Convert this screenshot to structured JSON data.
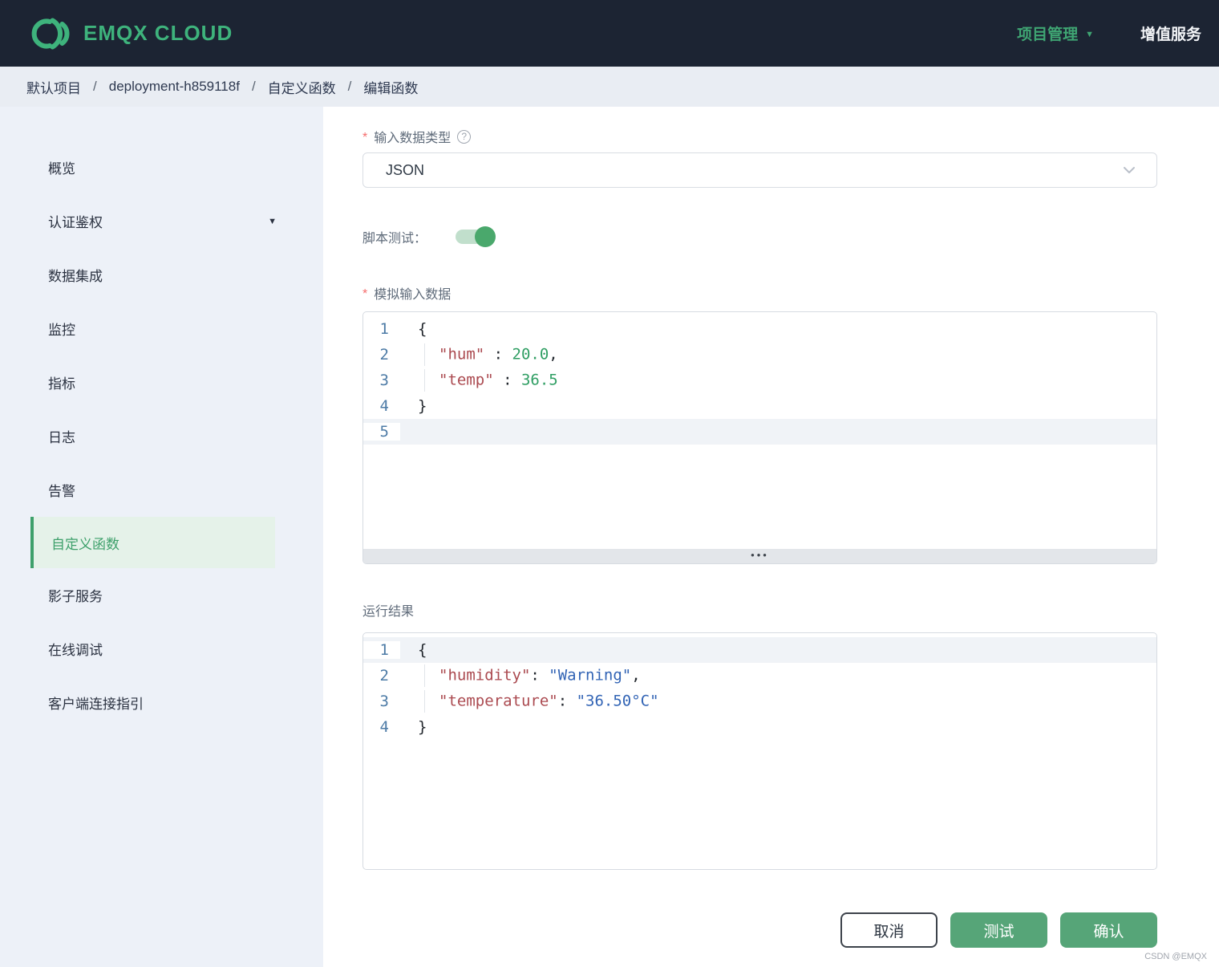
{
  "navbar": {
    "brand": "EMQX CLOUD",
    "project_menu": "项目管理",
    "value_added_services": "增值服务"
  },
  "breadcrumb": {
    "separator": "/",
    "items": [
      "默认项目",
      "deployment-h859118f",
      "自定义函数",
      "编辑函数"
    ]
  },
  "sidebar": {
    "items": [
      {
        "label": "概览",
        "active": false,
        "has_caret": false
      },
      {
        "label": "认证鉴权",
        "active": false,
        "has_caret": true
      },
      {
        "label": "数据集成",
        "active": false,
        "has_caret": false
      },
      {
        "label": "监控",
        "active": false,
        "has_caret": false
      },
      {
        "label": "指标",
        "active": false,
        "has_caret": false
      },
      {
        "label": "日志",
        "active": false,
        "has_caret": false
      },
      {
        "label": "告警",
        "active": false,
        "has_caret": false
      },
      {
        "label": "自定义函数",
        "active": true,
        "has_caret": false
      },
      {
        "label": "影子服务",
        "active": false,
        "has_caret": false
      },
      {
        "label": "在线调试",
        "active": false,
        "has_caret": false
      },
      {
        "label": "客户端连接指引",
        "active": false,
        "has_caret": false
      }
    ]
  },
  "form": {
    "input_type": {
      "required_mark": "*",
      "label": "输入数据类型",
      "help_icon": "?",
      "value": "JSON"
    },
    "script_test": {
      "label": "脚本测试：",
      "state": "on"
    },
    "sim_input": {
      "required_mark": "*",
      "label": "模拟输入数据"
    },
    "run_result": {
      "label": "运行结果"
    }
  },
  "editors": {
    "input": {
      "active_line": 5,
      "lines": [
        {
          "indent": false,
          "tokens": [
            {
              "text": "{",
              "type": "plain"
            }
          ]
        },
        {
          "indent": true,
          "tokens": [
            {
              "text": "\"hum\"",
              "type": "key"
            },
            {
              "text": " : ",
              "type": "plain"
            },
            {
              "text": "20.0",
              "type": "num"
            },
            {
              "text": ",",
              "type": "plain"
            }
          ]
        },
        {
          "indent": true,
          "tokens": [
            {
              "text": "\"temp\"",
              "type": "key"
            },
            {
              "text": " : ",
              "type": "plain"
            },
            {
              "text": "36.5",
              "type": "num"
            }
          ]
        },
        {
          "indent": false,
          "tokens": [
            {
              "text": "}",
              "type": "plain"
            }
          ]
        },
        {
          "indent": false,
          "tokens": []
        }
      ],
      "resize_dots": "•••"
    },
    "output": {
      "active_line": 1,
      "lines": [
        {
          "indent": false,
          "tokens": [
            {
              "text": "{",
              "type": "plain"
            }
          ]
        },
        {
          "indent": true,
          "tokens": [
            {
              "text": "\"humidity\"",
              "type": "key"
            },
            {
              "text": ": ",
              "type": "plain"
            },
            {
              "text": "\"Warning\"",
              "type": "str"
            },
            {
              "text": ",",
              "type": "plain"
            }
          ]
        },
        {
          "indent": true,
          "tokens": [
            {
              "text": "\"temperature\"",
              "type": "key"
            },
            {
              "text": ": ",
              "type": "plain"
            },
            {
              "text": "\"36.50°C\"",
              "type": "str"
            }
          ]
        },
        {
          "indent": false,
          "tokens": [
            {
              "text": "}",
              "type": "plain"
            }
          ]
        }
      ]
    }
  },
  "actions": {
    "cancel": "取消",
    "test": "测试",
    "confirm": "确认"
  },
  "watermark": "CSDN @EMQX",
  "colors": {
    "navbar_bg": "#1c2433",
    "brand_green": "#3eb37c",
    "nav_link_green": "#3fa573",
    "sidebar_bg": "#edf1f8",
    "active_item_green": "#3ea06b",
    "active_item_bg": "#e5f2e9",
    "button_green": "#56a578",
    "required_red": "#f56c6c",
    "code_key": "#ab4a50",
    "code_number": "#2f9e63",
    "code_string": "#3264b5",
    "line_number": "#4d7ba6",
    "active_line_bg": "#f0f3f7"
  }
}
